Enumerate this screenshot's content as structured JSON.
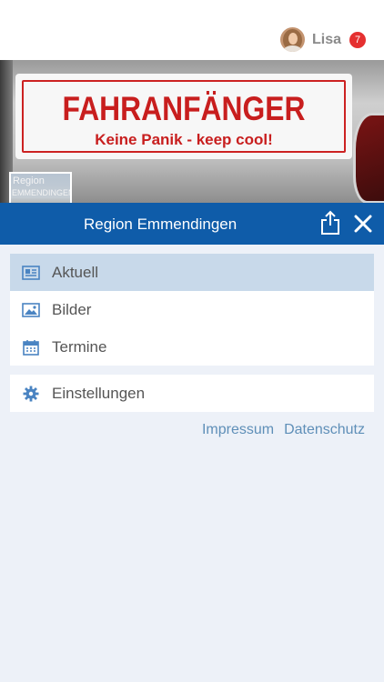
{
  "user": {
    "name": "Lisa",
    "notifications": "7",
    "avatar_icon": "user-avatar"
  },
  "hero": {
    "sign_title": "FAHRANFÄNGER",
    "sign_subtitle": "Keine Panik - keep cool!"
  },
  "thumbnail": {
    "line1": "Region",
    "line2": "EMMENDINGEN"
  },
  "header": {
    "title": "Region Emmendingen",
    "share_icon": "share-icon",
    "close_icon": "close-icon"
  },
  "menu": [
    {
      "label": "Aktuell",
      "icon": "newspaper-icon",
      "active": true
    },
    {
      "label": "Bilder",
      "icon": "image-icon",
      "active": false
    },
    {
      "label": "Termine",
      "icon": "calendar-icon",
      "active": false
    }
  ],
  "settings": {
    "label": "Einstellungen",
    "icon": "gear-icon"
  },
  "links": {
    "impressum": "Impressum",
    "datenschutz": "Datenschutz"
  },
  "colors": {
    "accent": "#0f5ca9",
    "active_row": "#c8d9ea",
    "badge": "#e53030",
    "link": "#5f8fb8",
    "background": "#edf1f8"
  }
}
